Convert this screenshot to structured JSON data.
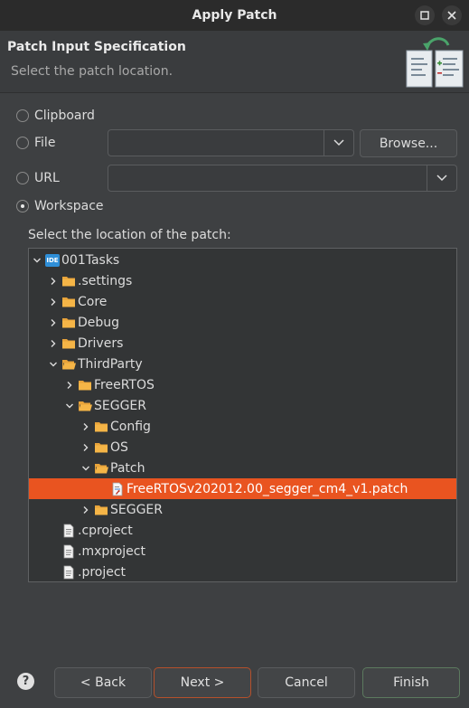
{
  "window": {
    "title": "Apply Patch"
  },
  "header": {
    "title": "Patch Input Specification",
    "subtitle": "Select the patch location."
  },
  "source": {
    "clipboard_label": "Clipboard",
    "file_label": "File",
    "file_value": "",
    "browse_label": "Browse...",
    "url_label": "URL",
    "url_value": "",
    "workspace_label": "Workspace",
    "selected": "Workspace"
  },
  "tree": {
    "label": "Select the location of the patch:",
    "items": [
      {
        "label": "001Tasks",
        "icon": "ide-project-icon",
        "expanded": true,
        "depth": 0
      },
      {
        "label": ".settings",
        "icon": "folder-icon",
        "expanded": false,
        "depth": 1
      },
      {
        "label": "Core",
        "icon": "folder-icon",
        "expanded": false,
        "depth": 1
      },
      {
        "label": "Debug",
        "icon": "folder-icon",
        "expanded": false,
        "depth": 1
      },
      {
        "label": "Drivers",
        "icon": "folder-icon",
        "expanded": false,
        "depth": 1
      },
      {
        "label": "ThirdParty",
        "icon": "folder-open-icon",
        "expanded": true,
        "depth": 1
      },
      {
        "label": "FreeRTOS",
        "icon": "folder-icon",
        "expanded": false,
        "depth": 2
      },
      {
        "label": "SEGGER",
        "icon": "folder-open-icon",
        "expanded": true,
        "depth": 2
      },
      {
        "label": "Config",
        "icon": "folder-icon",
        "expanded": false,
        "depth": 3
      },
      {
        "label": "OS",
        "icon": "folder-icon",
        "expanded": false,
        "depth": 3
      },
      {
        "label": "Patch",
        "icon": "folder-open-icon",
        "expanded": true,
        "depth": 3
      },
      {
        "label": "FreeRTOSv202012.00_segger_cm4_v1.patch",
        "icon": "patch-file-icon",
        "selected": true,
        "depth": 4
      },
      {
        "label": "SEGGER",
        "icon": "folder-icon",
        "expanded": false,
        "depth": 3
      },
      {
        "label": ".cproject",
        "icon": "file-icon",
        "depth": 1
      },
      {
        "label": ".mxproject",
        "icon": "file-icon",
        "depth": 1
      },
      {
        "label": ".project",
        "icon": "file-icon",
        "depth": 1
      }
    ]
  },
  "footer": {
    "help_label": "?",
    "back_label": "< Back",
    "next_label": "Next >",
    "cancel_label": "Cancel",
    "finish_label": "Finish"
  },
  "colors": {
    "accent": "#e95420",
    "background": "#3e4042",
    "folder": "#f0a030"
  }
}
